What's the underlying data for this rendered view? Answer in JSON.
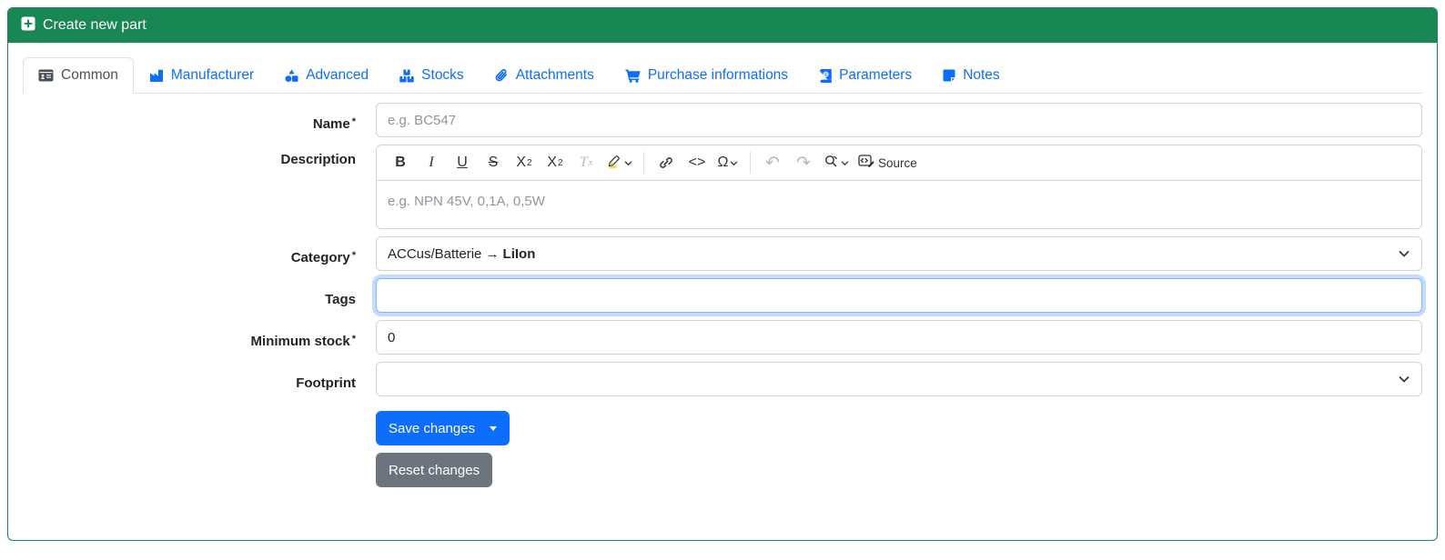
{
  "header": {
    "title": "Create new part"
  },
  "tabs": [
    {
      "label": "Common",
      "active": true
    },
    {
      "label": "Manufacturer"
    },
    {
      "label": "Advanced"
    },
    {
      "label": "Stocks"
    },
    {
      "label": "Attachments"
    },
    {
      "label": "Purchase informations"
    },
    {
      "label": "Parameters"
    },
    {
      "label": "Notes"
    }
  ],
  "required_marker": "*",
  "form": {
    "name": {
      "label": "Name",
      "placeholder": "e.g. BC547",
      "value": ""
    },
    "description": {
      "label": "Description",
      "placeholder": "e.g. NPN 45V, 0,1A, 0,5W",
      "value": ""
    },
    "category": {
      "label": "Category",
      "value_plain": "ACCus/Batterie →",
      "value_bold": "LiIon"
    },
    "tags": {
      "label": "Tags",
      "value": ""
    },
    "minimum_stock": {
      "label": "Minimum stock",
      "value": "0"
    },
    "footprint": {
      "label": "Footprint",
      "value": ""
    }
  },
  "editor_toolbar": {
    "bold": "B",
    "italic": "I",
    "underline": "U",
    "strikethrough": "S",
    "subscript_main": "X",
    "subscript_small": "2",
    "superscript_main": "X",
    "superscript_small": "2",
    "remove_format_main": "T",
    "remove_format_small": "x",
    "code": "<>",
    "special_char": "Ω",
    "undo": "↶",
    "redo": "↷",
    "source_label": "Source"
  },
  "buttons": {
    "save": "Save changes",
    "reset": "Reset changes"
  },
  "colors": {
    "success_green": "#198754",
    "primary_blue": "#0d6efd",
    "secondary_gray": "#6c757d",
    "highlight_yellow": "#f5d423"
  }
}
